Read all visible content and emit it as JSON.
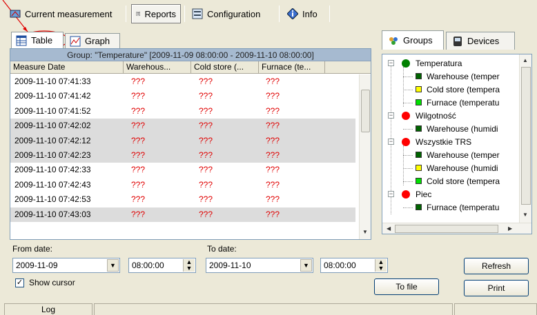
{
  "top_tabs": [
    {
      "label": "Current measurement",
      "icon": "gauge-icon"
    },
    {
      "label": "Reports",
      "icon": "report-icon",
      "active": true
    },
    {
      "label": "Configuration",
      "icon": "config-icon"
    },
    {
      "label": "Info",
      "icon": "info-icon"
    }
  ],
  "left_tabs": [
    {
      "label": "Table",
      "active": true
    },
    {
      "label": "Graph"
    }
  ],
  "group_title": "Group: \"Temperature\" [2009-11-09 08:00:00  -  2009-11-10 08:00:00]",
  "columns": [
    "Measure Date",
    "Warehous...",
    "Cold store (...",
    "Furnace (te..."
  ],
  "rows": [
    {
      "date": "2009-11-10 07:41:33",
      "v1": "???",
      "v2": "???",
      "v3": "???",
      "shaded": false
    },
    {
      "date": "2009-11-10 07:41:42",
      "v1": "???",
      "v2": "???",
      "v3": "???",
      "shaded": false
    },
    {
      "date": "2009-11-10 07:41:52",
      "v1": "???",
      "v2": "???",
      "v3": "???",
      "shaded": false
    },
    {
      "date": "2009-11-10 07:42:02",
      "v1": "???",
      "v2": "???",
      "v3": "???",
      "shaded": true
    },
    {
      "date": "2009-11-10 07:42:12",
      "v1": "???",
      "v2": "???",
      "v3": "???",
      "shaded": true
    },
    {
      "date": "2009-11-10 07:42:23",
      "v1": "???",
      "v2": "???",
      "v3": "???",
      "shaded": true
    },
    {
      "date": "2009-11-10 07:42:33",
      "v1": "???",
      "v2": "???",
      "v3": "???",
      "shaded": false
    },
    {
      "date": "2009-11-10 07:42:43",
      "v1": "???",
      "v2": "???",
      "v3": "???",
      "shaded": false
    },
    {
      "date": "2009-11-10 07:42:53",
      "v1": "???",
      "v2": "???",
      "v3": "???",
      "shaded": false
    },
    {
      "date": "2009-11-10 07:43:03",
      "v1": "???",
      "v2": "???",
      "v3": "???",
      "shaded": false
    }
  ],
  "right_tabs": [
    {
      "label": "Groups",
      "icon": "groups-icon",
      "active": true
    },
    {
      "label": "Devices",
      "icon": "devices-icon"
    }
  ],
  "tree": [
    {
      "label": "Temperatura",
      "level": 0,
      "color": "#008000"
    },
    {
      "label": "Warehouse (temper",
      "level": 1,
      "color": "#006400"
    },
    {
      "label": "Cold store (tempera",
      "level": 1,
      "color": "#ffff00"
    },
    {
      "label": "Furnace (temperatu",
      "level": 1,
      "color": "#00e000"
    },
    {
      "label": "Wilgotność",
      "level": 0,
      "color": "#ff0000"
    },
    {
      "label": "Warehouse (humidi",
      "level": 1,
      "color": "#006400"
    },
    {
      "label": "Wszystkie TRS",
      "level": 0,
      "color": "#ff0000"
    },
    {
      "label": "Warehouse (temper",
      "level": 1,
      "color": "#006400"
    },
    {
      "label": "Warehouse (humidi",
      "level": 1,
      "color": "#ffff00"
    },
    {
      "label": "Cold store (tempera",
      "level": 1,
      "color": "#00e000"
    },
    {
      "label": "Piec",
      "level": 0,
      "color": "#ff0000"
    },
    {
      "label": "Furnace (temperatu",
      "level": 1,
      "color": "#006400"
    }
  ],
  "from": {
    "label": "From date:",
    "date": "2009-11-09",
    "time": "08:00:00"
  },
  "to": {
    "label": "To date:",
    "date": "2009-11-10",
    "time": "08:00:00"
  },
  "show_cursor": {
    "label": "Show cursor",
    "checked": true
  },
  "buttons": {
    "refresh": "Refresh",
    "to_file": "To file",
    "print": "Print"
  },
  "status": {
    "log": "Log"
  },
  "colors": {
    "annotation": "#e00000",
    "error_text": "#e00000",
    "header_band": "#a6bad0"
  }
}
